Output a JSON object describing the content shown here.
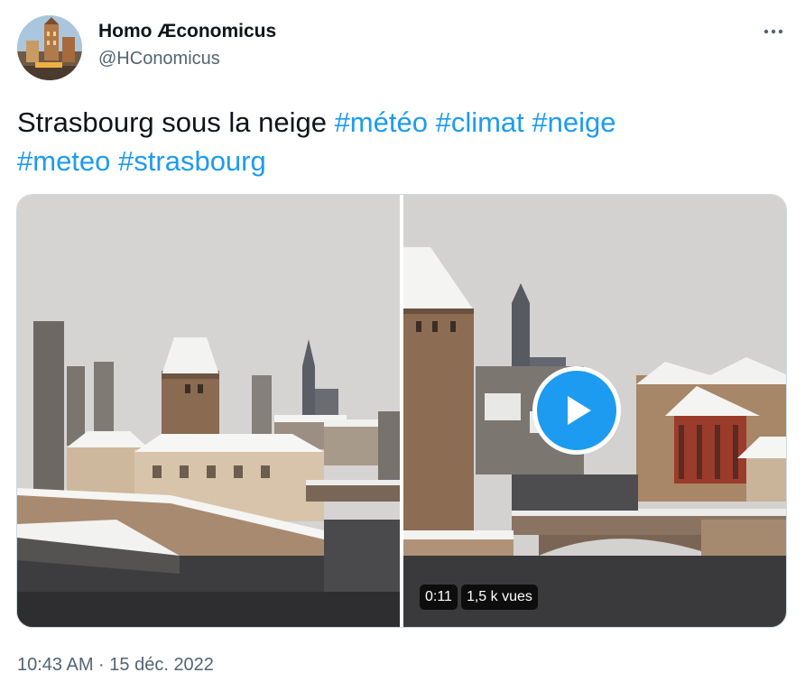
{
  "tweet": {
    "author": {
      "display_name": "Homo Æconomicus",
      "handle": "@HConomicus"
    },
    "more_icon": "more-horizontal-icon",
    "text": {
      "plain": "Strasbourg sous la neige ",
      "hashtags": [
        "#météo",
        "#climat",
        "#neige",
        "#meteo",
        "#strasbourg"
      ]
    },
    "media": {
      "video": {
        "duration": "0:11",
        "views": "1,5 k vues",
        "play_icon": "play-icon"
      }
    },
    "timestamp": "10:43 AM · 15 déc. 2022"
  },
  "colors": {
    "accent": "#1d9bf0",
    "text_primary": "#0f1419",
    "text_secondary": "#536471",
    "border": "#cfd9de"
  }
}
